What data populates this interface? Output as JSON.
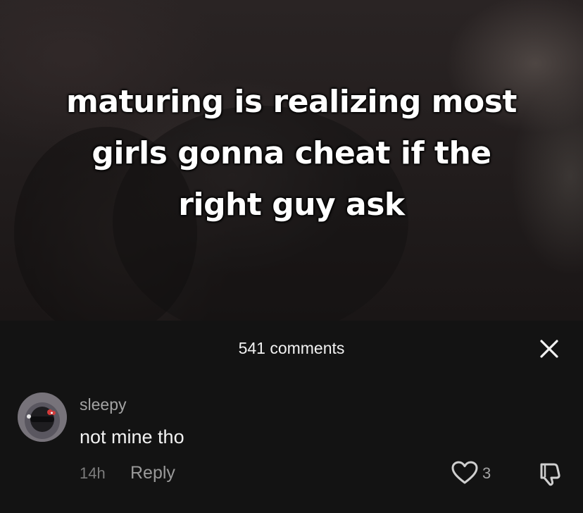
{
  "video": {
    "caption_lines": [
      "maturing is realizing most",
      "girls gonna cheat if the",
      "right guy ask"
    ]
  },
  "comments_panel": {
    "count_label": "541 comments",
    "close_icon": "close-icon"
  },
  "comment": {
    "username": "sleepy",
    "text": "not mine tho",
    "timestamp": "14h",
    "reply_label": "Reply",
    "like_icon": "heart-icon",
    "like_count": "3",
    "dislike_icon": "thumbs-down-icon"
  },
  "colors": {
    "panel_background": "#131313",
    "primary_text": "#f2f2f2",
    "secondary_text": "#a3a3a3"
  }
}
